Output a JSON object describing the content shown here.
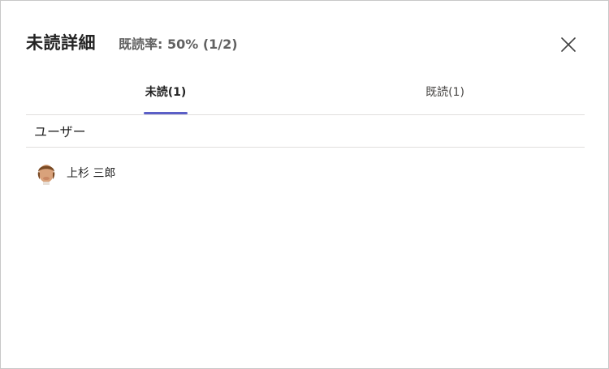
{
  "dialog": {
    "title": "未読詳細",
    "read_rate": "既読率: 50% (1/2)",
    "close_icon": "close-icon"
  },
  "tabs": [
    {
      "label": "未読(1)",
      "active": true
    },
    {
      "label": "既読(1)",
      "active": false
    }
  ],
  "accent_color": "#5b5fc7",
  "list": {
    "column_header": "ユーザー",
    "users": [
      {
        "name": "上杉 三郎",
        "avatar_icon": "user-avatar-icon"
      }
    ]
  }
}
